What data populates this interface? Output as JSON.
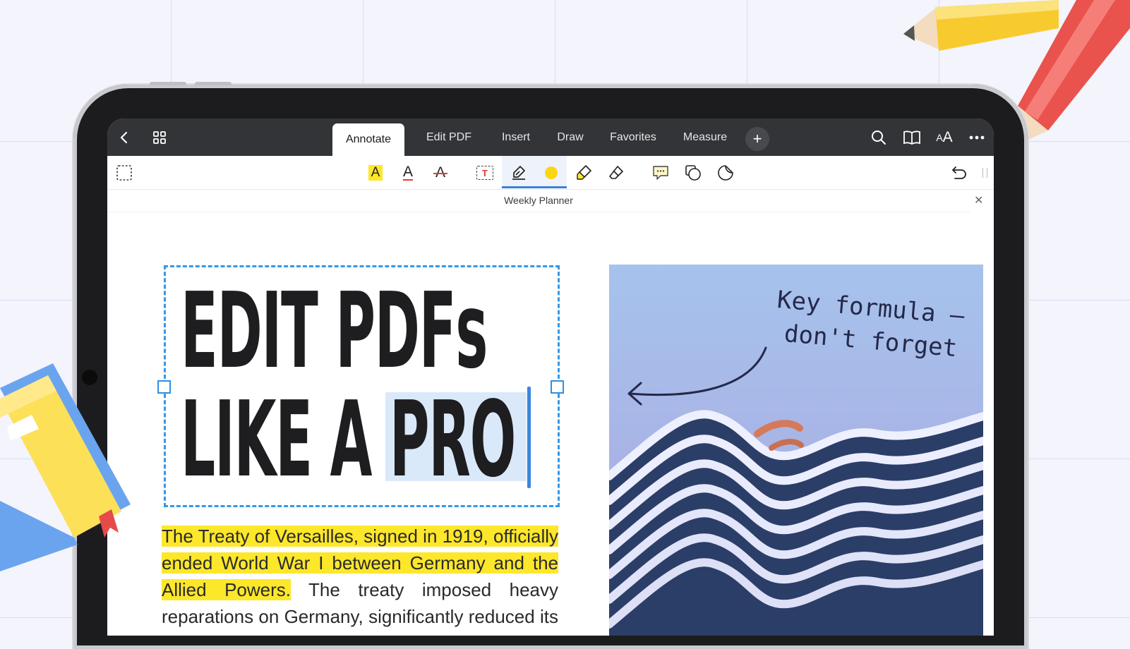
{
  "topbar": {
    "tabs": [
      {
        "label": "Annotate",
        "active": true
      },
      {
        "label": "Edit PDF",
        "active": false
      },
      {
        "label": "Insert",
        "active": false
      },
      {
        "label": "Draw",
        "active": false
      },
      {
        "label": "Favorites",
        "active": false
      },
      {
        "label": "Measure",
        "active": false
      }
    ],
    "left_icons": [
      "back-chevron-icon",
      "grid-icon"
    ],
    "add_tab_label": "+",
    "right_icons": [
      "search-icon",
      "book-icon",
      "text-size-icon",
      "more-icon"
    ],
    "text_size_label": "AA"
  },
  "toolbar": {
    "icons": [
      "select-area-icon",
      "highlight-text-icon",
      "underline-text-icon",
      "strikethrough-text-icon",
      "text-box-icon",
      "pen-icon",
      "color-dot-icon",
      "highlighter-icon",
      "eraser-icon",
      "comment-icon",
      "shapes-icon",
      "sticker-icon",
      "undo-icon"
    ],
    "highlight_letter": "A",
    "underline_letter": "A",
    "strike_letter": "A",
    "textbox_letter": "T",
    "selected_tool": "pen",
    "accent_color": "#3b82d6",
    "pen_color": "#fcd613"
  },
  "document": {
    "title": "Weekly Planner",
    "headline_line1": "EDIT PDFs",
    "headline_line2_prefix": "LIKE A ",
    "headline_line2_selected": "PRO",
    "paragraph_highlighted": "The Treaty of Versailles, signed in 1919, officially ended World War I between Germany and the Allied Powers.",
    "paragraph_rest": " The treaty imposed heavy reparations on Germany, significantly reduced its military capacity",
    "note_line1": "Key formula –",
    "note_line2": "don't forget",
    "highlight_color": "#fde72a"
  }
}
